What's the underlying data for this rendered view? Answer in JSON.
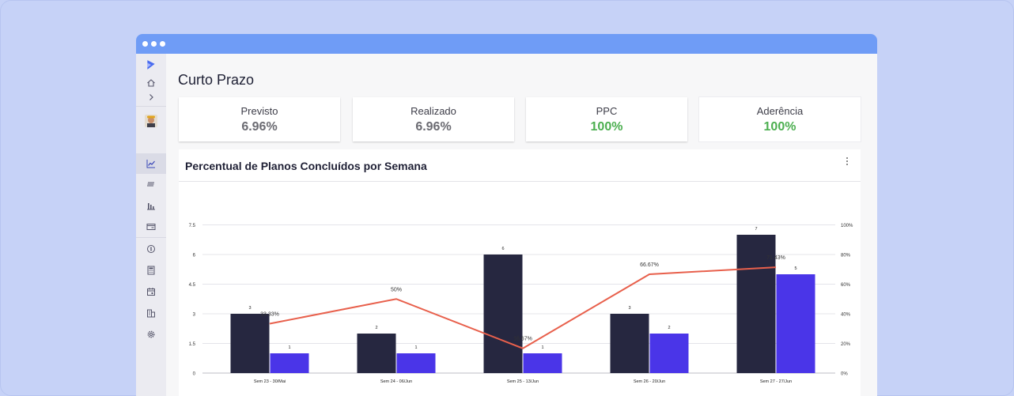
{
  "page": {
    "title": "Curto Prazo"
  },
  "sidebar": {
    "icons": [
      "logo-icon",
      "home-icon",
      "chevron-right-icon",
      "avatar",
      "trend-chart-icon",
      "list-icon",
      "bar-chart-icon",
      "card-icon",
      "coin-icon",
      "calculator-icon",
      "calendar-icon",
      "building-icon",
      "settings-icon"
    ],
    "active": "trend-chart-icon"
  },
  "kpis": [
    {
      "label": "Previsto",
      "value": "6.96%",
      "color": "#6b6b72"
    },
    {
      "label": "Realizado",
      "value": "6.96%",
      "color": "#6b6b72"
    },
    {
      "label": "PPC",
      "value": "100%",
      "color": "#4caf50"
    },
    {
      "label": "Aderência",
      "value": "100%",
      "color": "#4caf50"
    }
  ],
  "chart": {
    "title": "Percentual de Planos Concluídos por Semana"
  },
  "chart_data": {
    "type": "bar",
    "categories": [
      "Sem 23 - 30/Mai",
      "Sem 24 - 06/Jun",
      "Sem 25 - 13/Jun",
      "Sem 26 - 20/Jun",
      "Sem 27 - 27/Jun"
    ],
    "series": [
      {
        "values": [
          3,
          2,
          6,
          3,
          7
        ],
        "color": "#262740"
      },
      {
        "values": [
          1,
          1,
          1,
          2,
          5
        ],
        "color": "#4a35e8"
      }
    ],
    "line": {
      "values": [
        33.33,
        50,
        16.67,
        66.67,
        71.43
      ],
      "labels": [
        "33.33%",
        "50%",
        "16.67%",
        "66.67%",
        "71.43%"
      ],
      "color": "#e8604c"
    },
    "y_left": {
      "ticks": [
        "0",
        "1.5",
        "3",
        "4.5",
        "6",
        "7.5"
      ],
      "min": 0,
      "max": 7.5
    },
    "y_right": {
      "ticks": [
        "0%",
        "20%",
        "40%",
        "60%",
        "80%",
        "100%"
      ],
      "min": 0,
      "max": 100
    },
    "grid": true
  }
}
